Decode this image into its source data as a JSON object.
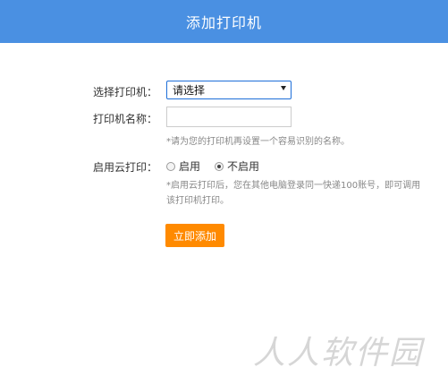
{
  "dialog": {
    "title": "添加打印机"
  },
  "form": {
    "printer_select": {
      "label": "选择打印机：",
      "value": "请选择"
    },
    "printer_name": {
      "label": "打印机名称：",
      "value": ""
    },
    "name_hint": "*请为您的打印机再设置一个容易识别的名称。",
    "cloud_print": {
      "label": "启用云打印：",
      "options": [
        {
          "label": "启用",
          "selected": false
        },
        {
          "label": "不启用",
          "selected": true
        }
      ]
    },
    "cloud_hint_line1": "*启用云打印后，您在其他电脑登录同一快递100账号，即可调用",
    "cloud_hint_line2": "该打印机打印。"
  },
  "actions": {
    "submit_label": "立即添加"
  },
  "watermark": "人人软件园",
  "colors": {
    "header": "#4a90e2",
    "submit": "#ff8a00",
    "select_border": "#1e6fd9"
  }
}
